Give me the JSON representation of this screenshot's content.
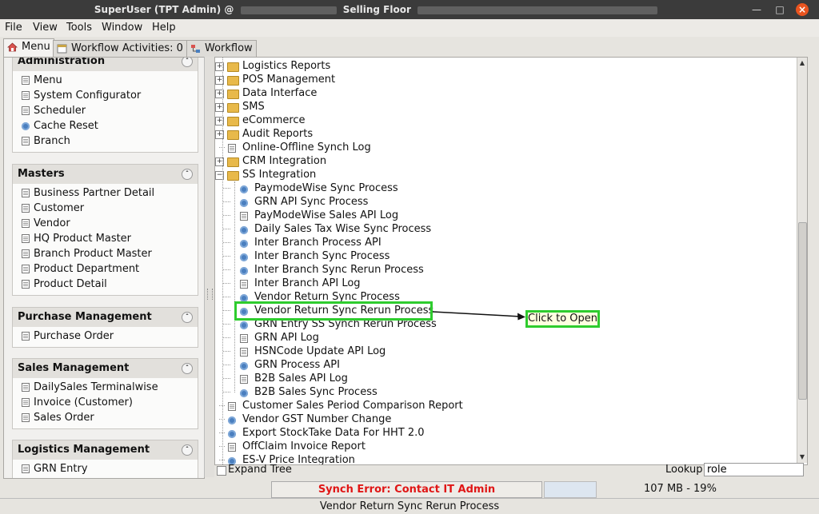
{
  "window": {
    "title_left": "SuperUser (TPT Admin) @",
    "title_right": "Selling Floor"
  },
  "menubar": [
    "File",
    "View",
    "Tools",
    "Window",
    "Help"
  ],
  "tabs": [
    {
      "label": "Menu"
    },
    {
      "label": "Workflow Activities: 0"
    },
    {
      "label": "Workflow"
    }
  ],
  "sidebar": {
    "sections": [
      {
        "title": "Administration",
        "items": [
          {
            "label": "Menu",
            "icon": "doc-icon"
          },
          {
            "label": "System Configurator",
            "icon": "doc-icon"
          },
          {
            "label": "Scheduler",
            "icon": "doc-icon"
          },
          {
            "label": "Cache Reset",
            "icon": "gear-icon"
          },
          {
            "label": "Branch",
            "icon": "doc-icon"
          }
        ]
      },
      {
        "title": "Masters",
        "items": [
          {
            "label": "Business Partner Detail",
            "icon": "doc-icon"
          },
          {
            "label": "Customer",
            "icon": "doc-icon"
          },
          {
            "label": "Vendor",
            "icon": "doc-icon"
          },
          {
            "label": "HQ Product Master",
            "icon": "doc-icon"
          },
          {
            "label": "Branch Product Master",
            "icon": "doc-icon"
          },
          {
            "label": "Product Department",
            "icon": "doc-icon"
          },
          {
            "label": "Product Detail",
            "icon": "doc-icon"
          }
        ]
      },
      {
        "title": "Purchase Management",
        "items": [
          {
            "label": "Purchase Order",
            "icon": "doc-icon"
          }
        ]
      },
      {
        "title": "Sales Management",
        "items": [
          {
            "label": "DailySales Terminalwise",
            "icon": "doc-icon"
          },
          {
            "label": "Invoice (Customer)",
            "icon": "doc-icon"
          },
          {
            "label": "Sales Order",
            "icon": "doc-icon"
          }
        ]
      },
      {
        "title": "Logistics Management",
        "items": [
          {
            "label": "GRN Entry",
            "icon": "doc-icon"
          }
        ]
      }
    ]
  },
  "tree": {
    "nodes": [
      {
        "label": "Logistics Reports",
        "type": "folder",
        "level": 0
      },
      {
        "label": "POS Management",
        "type": "folder",
        "level": 0
      },
      {
        "label": "Data Interface",
        "type": "folder",
        "level": 0
      },
      {
        "label": "SMS",
        "type": "folder",
        "level": 0
      },
      {
        "label": "eCommerce",
        "type": "folder",
        "level": 0
      },
      {
        "label": "Audit Reports",
        "type": "folder",
        "level": 0
      },
      {
        "label": "Online-Offline Synch Log",
        "type": "doc",
        "level": 0
      },
      {
        "label": "CRM Integration",
        "type": "folder",
        "level": 0
      },
      {
        "label": "SS Integration",
        "type": "folder-open",
        "level": 0
      },
      {
        "label": "PaymodeWise Sync Process",
        "type": "gear",
        "level": 1
      },
      {
        "label": "GRN API Sync Process",
        "type": "gear",
        "level": 1
      },
      {
        "label": "PayModeWise Sales API Log",
        "type": "doc",
        "level": 1
      },
      {
        "label": "Daily Sales Tax Wise Sync Process",
        "type": "gear",
        "level": 1
      },
      {
        "label": "Inter Branch Process API",
        "type": "gear",
        "level": 1
      },
      {
        "label": "Inter Branch Sync Process",
        "type": "gear",
        "level": 1
      },
      {
        "label": "Inter Branch Sync Rerun Process",
        "type": "gear",
        "level": 1
      },
      {
        "label": "Inter Branch API Log",
        "type": "doc",
        "level": 1
      },
      {
        "label": "Vendor Return Sync Process",
        "type": "gear",
        "level": 1
      },
      {
        "label": "Vendor Return Sync Rerun Process",
        "type": "gear",
        "level": 1
      },
      {
        "label": "GRN Entry SS Synch Rerun Process",
        "type": "gear",
        "level": 1
      },
      {
        "label": "GRN API Log",
        "type": "doc",
        "level": 1
      },
      {
        "label": "HSNCode Update API Log",
        "type": "doc",
        "level": 1
      },
      {
        "label": "GRN Process API",
        "type": "gear",
        "level": 1
      },
      {
        "label": "B2B Sales API Log",
        "type": "doc",
        "level": 1
      },
      {
        "label": "B2B Sales Sync Process",
        "type": "gear",
        "level": 1
      },
      {
        "label": "Customer Sales Period Comparison Report",
        "type": "doc",
        "level": 0
      },
      {
        "label": "Vendor GST Number Change",
        "type": "gear",
        "level": 0
      },
      {
        "label": "Export StockTake Data For HHT 2.0",
        "type": "gear",
        "level": 0
      },
      {
        "label": "OffClaim Invoice Report",
        "type": "doc",
        "level": 0
      },
      {
        "label": "ES-V Price Integration",
        "type": "gear",
        "level": 0
      }
    ],
    "callout": "Click to Open"
  },
  "footer": {
    "expand_tree": "Expand Tree",
    "lookup_label": "Lookup",
    "lookup_value": "role",
    "sync_error": "Synch Error: Contact IT Admin",
    "memory": "107 MB - 19%",
    "status_text": "Vendor Return Sync Rerun Process"
  },
  "colors": {
    "highlight": "#2ecc2e",
    "error": "#e01616",
    "close_button": "#e9541f"
  }
}
